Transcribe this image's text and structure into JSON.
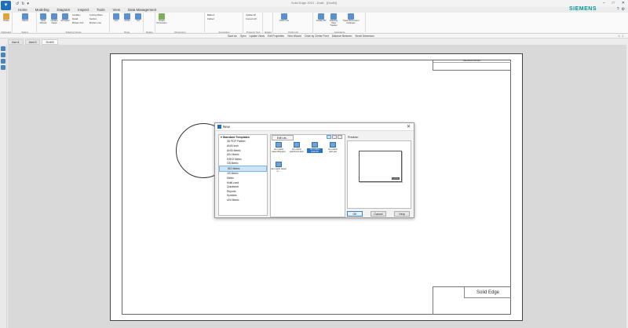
{
  "window": {
    "title": "Solid Edge 2021 - Draft - [Draft3]"
  },
  "quick_access": [
    "↺",
    "↻",
    "▾"
  ],
  "ribbon_tabs": [
    "Home",
    "Modeling",
    "Diagram",
    "Inspect",
    "Tools",
    "View",
    "Data Management"
  ],
  "brand": "SIEMENS",
  "ribbon_groups": [
    {
      "label": "Clipboard",
      "buttons": [
        "Paste"
      ]
    },
    {
      "label": "Select",
      "buttons": [
        "Select"
      ]
    },
    {
      "label": "Drawing Views",
      "buttons": [
        "View Wizard",
        "Update Views",
        "Principal",
        "Auxiliary",
        "Detail",
        "Broken-Out",
        "Cutting Plane",
        "Section",
        "Broken Line"
      ]
    },
    {
      "label": "Draw",
      "buttons": [
        "Line",
        "Circle",
        "Arc"
      ]
    },
    {
      "label": "Relate",
      "buttons": []
    },
    {
      "label": "Dimension",
      "buttons": [
        "Smart Dimension"
      ]
    },
    {
      "label": "Annotation",
      "buttons": [
        "Balloon",
        "Callout"
      ]
    },
    {
      "label": "Property Text",
      "buttons": [
        "Update All",
        "Convert All"
      ]
    },
    {
      "label": "Edges",
      "buttons": []
    },
    {
      "label": "Parts List",
      "buttons": [
        "Parts List"
      ]
    },
    {
      "label": "Assistants",
      "buttons": [
        "Create 3D",
        "Drawing View Tracker",
        "Track Dimension Changes"
      ]
    }
  ],
  "command_bar": [
    "Save As",
    "Open",
    "Update Views",
    "Edit Properties",
    "View Wizard",
    "Circle by Center Point",
    "Distance Between",
    "Smart Dimension"
  ],
  "command_bar_right": "1 : 1",
  "doc_tabs": [
    "Asm1",
    "Asm3",
    "Draft3"
  ],
  "drawing": {
    "revision_header": "REVISION HISTORY",
    "title_block_brand": "Solid Edge"
  },
  "dialog": {
    "title": "New",
    "tree_root": "Standard Templates",
    "tree_items": [
      "3D PDF Publish",
      "ANSI Inch",
      "ANSI Metric",
      "DIN Metric",
      "ESKD Metric",
      "GB Metric",
      "ISO Metric",
      "JIS Metric",
      "Metric",
      "Multi-cond",
      "Quickstart",
      "Reports",
      "Symbols",
      "UNI Metric"
    ],
    "tree_selected": "ISO Metric",
    "edit_list_label": "Edit List...",
    "files": [
      {
        "name": "iso metric assembly.asm"
      },
      {
        "name": "iso metric weldment.asm"
      },
      {
        "name": "iso metric draft.dft"
      },
      {
        "name": "iso metric part.par"
      },
      {
        "name": "iso metric sheet m..."
      }
    ],
    "selected_file": "iso metric draft.dft",
    "preview_label": "Preview:",
    "buttons": {
      "ok": "OK",
      "cancel": "Cancel",
      "help": "Help"
    }
  }
}
